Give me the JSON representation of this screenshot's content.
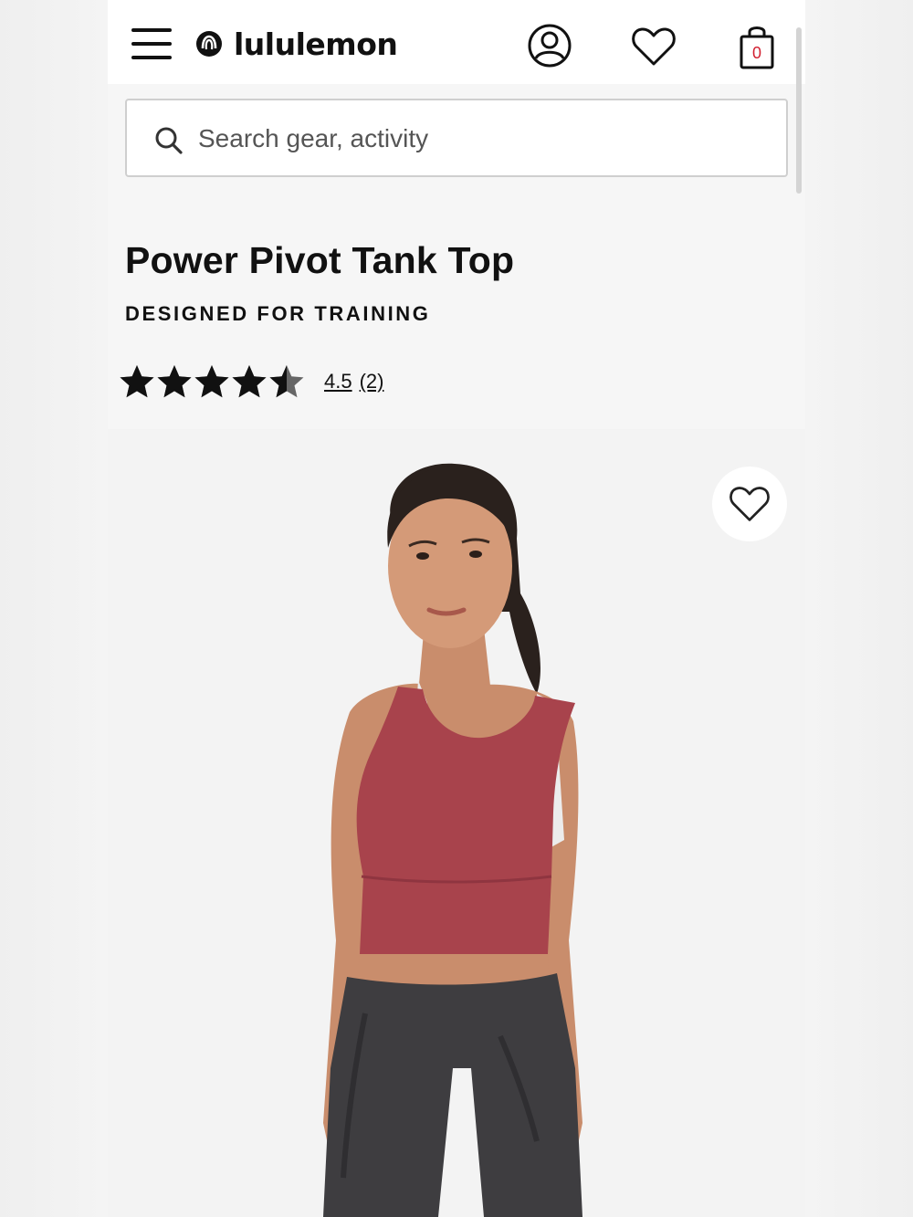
{
  "header": {
    "logo_text": "lululemon",
    "bag_count": "0"
  },
  "search": {
    "placeholder": "Search gear, activity"
  },
  "product": {
    "title": "Power Pivot Tank Top",
    "subtitle": "DESIGNED FOR TRAINING",
    "rating_value": "4.5",
    "review_count": "(2)",
    "rating_fraction": 0.9,
    "colors": {
      "top": "#a8434c",
      "leggings": "#3e3d40",
      "background": "#f3f3f3"
    }
  },
  "icons": {
    "menu": "hamburger-menu-icon",
    "logo": "lululemon-logo-icon",
    "account": "account-icon",
    "wishlist": "heart-icon",
    "bag": "shopping-bag-icon",
    "search": "search-icon",
    "favorite": "heart-outline-icon"
  }
}
